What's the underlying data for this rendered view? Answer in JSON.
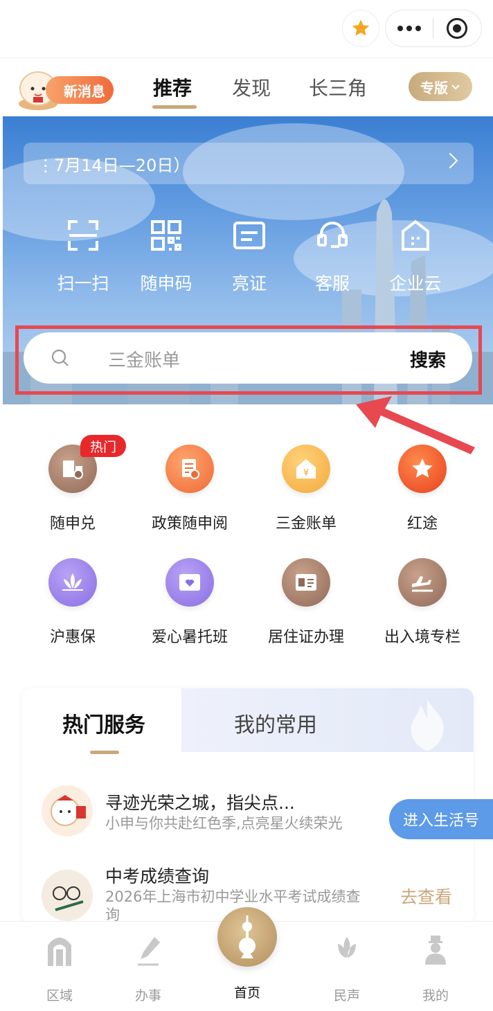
{
  "header": {
    "news_label": "新消息",
    "tabs": [
      "推荐",
      "发现",
      "长三角"
    ],
    "special_label": "专版"
  },
  "banner": {
    "notice_text": "⋮7月14日—20日）"
  },
  "quick_actions": [
    {
      "label": "扫一扫",
      "icon": "scan-icon"
    },
    {
      "label": "随申码",
      "icon": "qrcode-icon"
    },
    {
      "label": "亮证",
      "icon": "id-card-icon"
    },
    {
      "label": "客服",
      "icon": "headset-icon"
    },
    {
      "label": "企业云",
      "icon": "building-icon"
    }
  ],
  "search": {
    "placeholder": "三金账单",
    "button_label": "搜索"
  },
  "services": [
    {
      "label": "随申兑",
      "badge": "热门",
      "color": "#a37e6b"
    },
    {
      "label": "政策随申阅",
      "color": "#f2844a"
    },
    {
      "label": "三金账单",
      "color": "#f7b54a"
    },
    {
      "label": "红途",
      "color": "#f0582a"
    },
    {
      "label": "沪惠保",
      "color": "#9b82e8"
    },
    {
      "label": "爱心暑托班",
      "color": "#9b82e8"
    },
    {
      "label": "居住证办理",
      "color": "#a37e6b"
    },
    {
      "label": "出入境专栏",
      "color": "#a37e6b"
    }
  ],
  "card": {
    "tabs": [
      "热门服务",
      "我的常用"
    ],
    "items": [
      {
        "title": "寻迹光荣之城，指尖点...",
        "subtitle": "小申与你共赴红色季,点亮星火续荣光"
      },
      {
        "title": "中考成绩查询",
        "subtitle": "2026年上海市初中学业水平考试成绩查询",
        "action": "去查看"
      }
    ]
  },
  "floating": {
    "life_label": "进入生活号"
  },
  "bottom_nav": [
    {
      "label": "区域"
    },
    {
      "label": "办事"
    },
    {
      "label": "首页"
    },
    {
      "label": "民声"
    },
    {
      "label": "我的"
    }
  ],
  "colors": {
    "accent_gold": "#c9a779",
    "highlight_red": "#e8484f",
    "hot_badge": "#e8282b"
  }
}
